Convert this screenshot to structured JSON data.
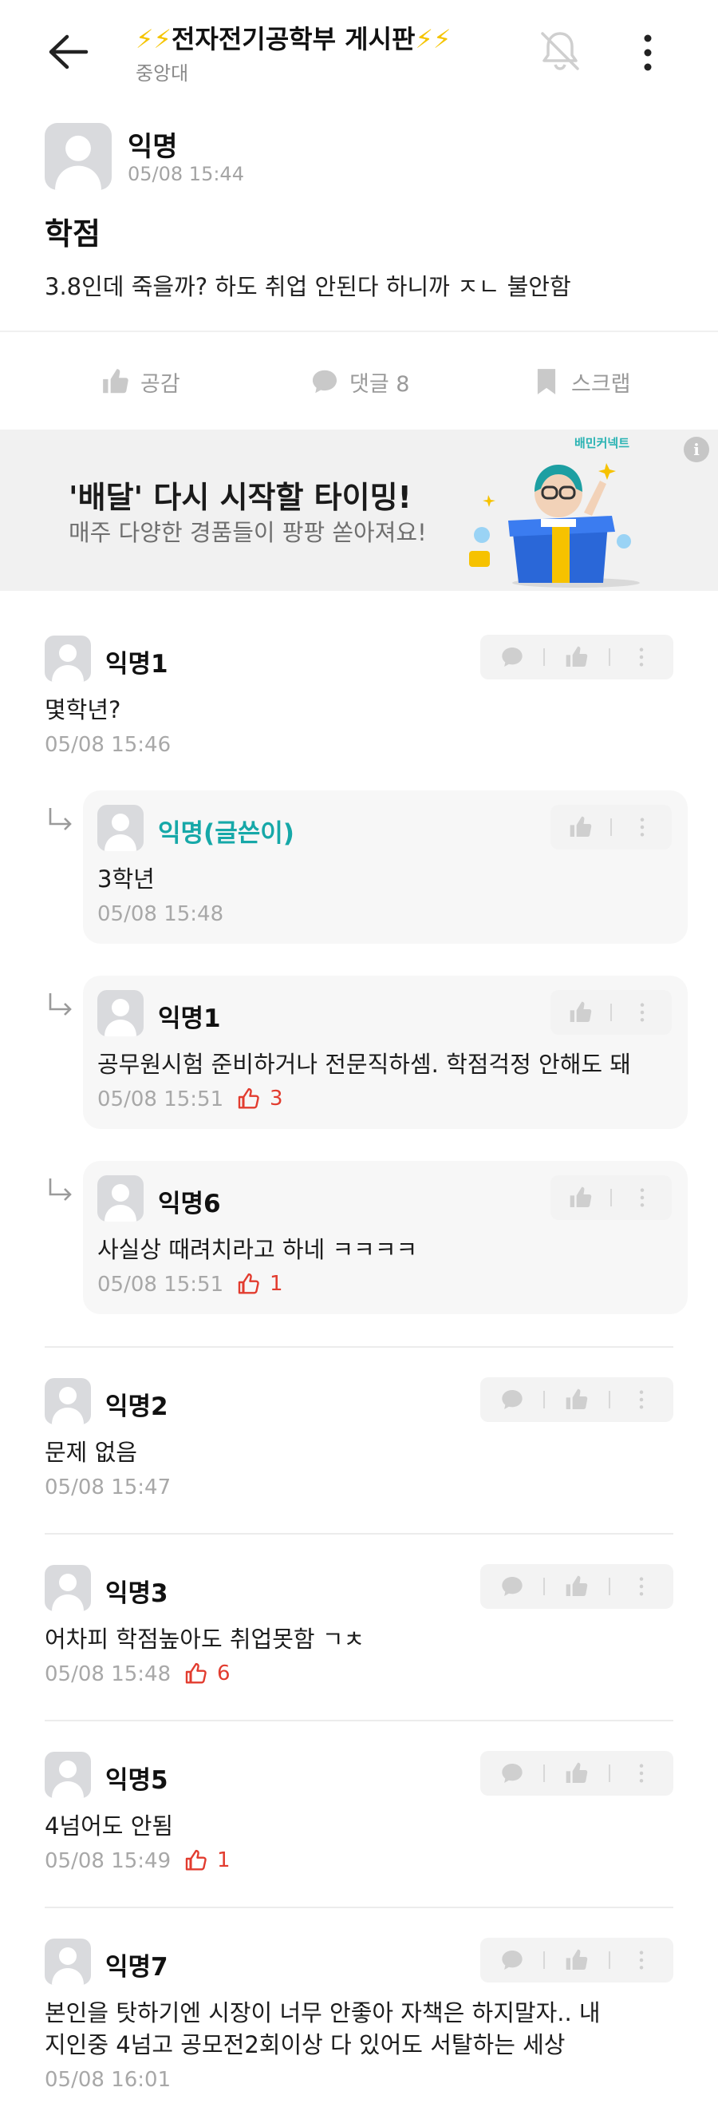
{
  "header": {
    "board_title": "전자전기공학부 게시판",
    "school": "중앙대"
  },
  "post": {
    "author": "익명",
    "time": "05/08 15:44",
    "title": "학점",
    "body": "3.8인데 죽을까? 하도 취업 안된다 하니까 ㅈㄴ 불안함"
  },
  "actions": {
    "like_label": "공감",
    "comment_label": "댓글 8",
    "scrap_label": "스크랩"
  },
  "ad": {
    "headline": "'배달' 다시 시작할 타이밍!",
    "subline": "매주 다양한 경품들이 팡팡 쏟아져요!",
    "brand": "배민커넥트",
    "info": "i"
  },
  "comments": [
    {
      "author": "익명1",
      "text": "몇학년?",
      "time": "05/08 15:46",
      "likes": ""
    },
    {
      "author": "익명(글쓴이)",
      "text": "3학년",
      "time": "05/08 15:48",
      "likes": "",
      "reply": true
    },
    {
      "author": "익명1",
      "text": "공무원시험 준비하거나 전문직하셈. 학점걱정 안해도 돼",
      "time": "05/08 15:51",
      "likes": "3",
      "reply": true
    },
    {
      "author": "익명6",
      "text": "사실상 때려치라고 하네 ㅋㅋㅋㅋ",
      "time": "05/08 15:51",
      "likes": "1",
      "reply": true
    },
    {
      "author": "익명2",
      "text": "문제 없음",
      "time": "05/08 15:47",
      "likes": ""
    },
    {
      "author": "익명3",
      "text": "어차피 학점높아도 취업못함 ㄱㅊ",
      "time": "05/08 15:48",
      "likes": "6"
    },
    {
      "author": "익명5",
      "text": "4넘어도 안됨",
      "time": "05/08 15:49",
      "likes": "1"
    },
    {
      "author": "익명7",
      "text_line1": "본인을 탓하기엔 시장이 너무 안좋아 자책은 하지말자.. 내",
      "text_line2": "지인중 4넘고 공모전2회이상 다 있어도 서탈하는 세상",
      "time": "05/08 16:01",
      "likes": ""
    }
  ],
  "colors": {
    "accent_teal": "#16a8a8",
    "like_red": "#e23c2f",
    "bolt_yellow": "#f5c400"
  }
}
